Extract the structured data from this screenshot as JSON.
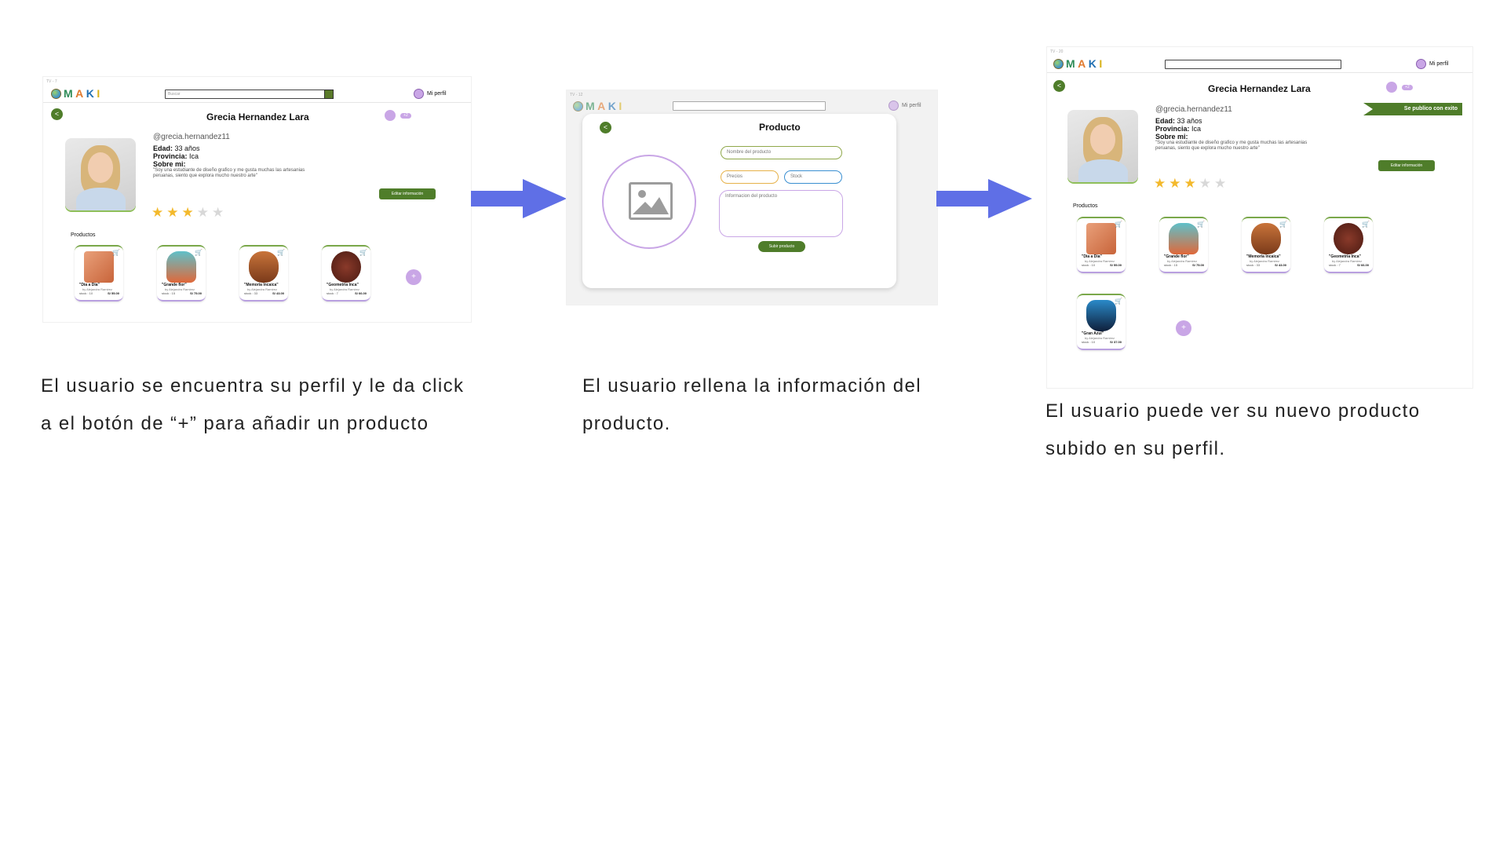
{
  "app": {
    "logo": {
      "m": "M",
      "a": "A",
      "k": "K",
      "i": "I"
    },
    "search_placeholder": "Buscar",
    "profile_link": "Mi perfil"
  },
  "screens": [
    {
      "tag": "TV - 7"
    },
    {
      "tag": "TV - 12"
    },
    {
      "tag": "TV - 20"
    }
  ],
  "profile": {
    "name": "Grecia Hernandez Lara",
    "handle": "@grecia.hernandez11",
    "edad_label": "Edad:",
    "edad_value": "33 años",
    "provincia_label": "Provincia:",
    "provincia_value": "Ica",
    "sobre_label": "Sobre mi:",
    "about": "\"Soy una estudiante de diseño grafico y me gusta muchas las artesanias peruanas, siento que explora mucho nuestro arte\"",
    "rating": 3,
    "rating_max": 5,
    "mail_badge": "+2",
    "edit_button": "Editar información",
    "products_title": "Productos",
    "plus": "+"
  },
  "products": [
    {
      "title": "\"Dia a Dia\"",
      "by": "by Alejandra Ramirez",
      "stock": "stock : 10",
      "price": "S/ 55.00",
      "colors": [
        "#e9a07a",
        "#c8643a"
      ]
    },
    {
      "title": "\"Grande flor\"",
      "by": "by Alejandra Ramirez",
      "stock": "stock : 15",
      "price": "S/ 75.00",
      "colors": [
        "#5fc0c9",
        "#e0683a"
      ]
    },
    {
      "title": "\"Memoria Incaica\"",
      "by": "by Alejandra Ramirez",
      "stock": "stock : 33",
      "price": "S/ 43.00",
      "colors": [
        "#c9743a",
        "#7a3a1a"
      ]
    },
    {
      "title": "\"Geometria Inca\"",
      "by": "by Alejandra Ramirez",
      "stock": "stock : 7",
      "price": "S/ 66.00",
      "colors": [
        "#8a3a2a",
        "#4a1a12"
      ]
    }
  ],
  "new_product": {
    "title": "\"Gran Azul\"",
    "by": "by Alejandra Ramirez",
    "stock": "stock : 10",
    "price": "S/ 37.00",
    "colors": [
      "#2a8ac9",
      "#0f1f3a"
    ]
  },
  "modal": {
    "title": "Producto",
    "name_placeholder": "Nombre del producto",
    "price_placeholder": "Precios",
    "stock_placeholder": "Stock",
    "info_placeholder": "Informacion del producto",
    "submit": "Subir producto"
  },
  "toast": "Se publico con exito",
  "captions": {
    "step1_line1": "El usuario se encuentra su perfil y le da click",
    "step1_line2": "a el botón de “+” para añadir un producto",
    "step2_line1": "El usuario rellena la información del",
    "step2_line2": "producto.",
    "step3_line1": "El usuario puede ver su nuevo producto",
    "step3_line2": "subido en su perfil."
  },
  "colors": {
    "accent_green": "#4f7d2a",
    "accent_purple": "#c9a6e6",
    "arrow": "#5f6fe6",
    "star": "#f3b92c"
  }
}
